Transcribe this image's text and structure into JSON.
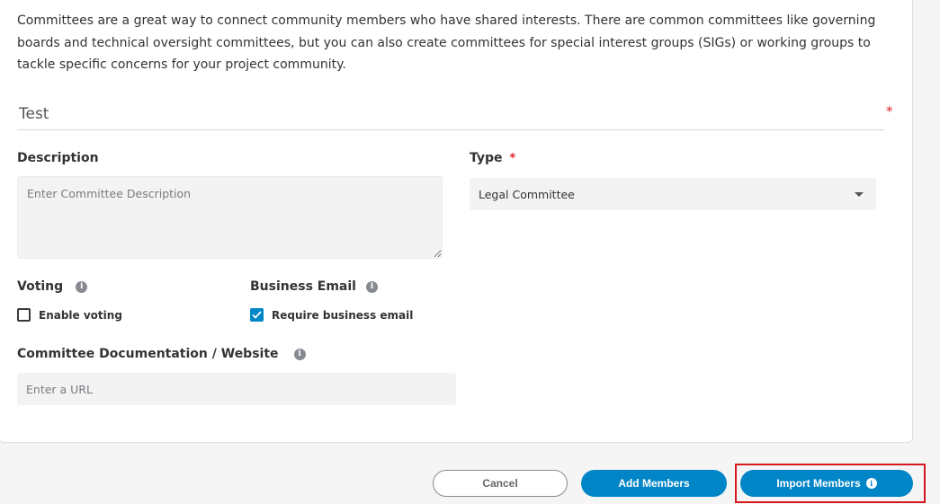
{
  "intro_text": "Committees are a great way to connect community members who have shared interests. There are common committees like governing boards and technical oversight committees, but you can also create committees for special interest groups (SIGs) or working groups to tackle specific concerns for your project community.",
  "name_field": {
    "value": "Test",
    "required_mark": "*"
  },
  "description": {
    "label": "Description",
    "placeholder": "Enter Committee Description"
  },
  "type": {
    "label": "Type",
    "required_mark": "*",
    "selected": "Legal Committee"
  },
  "voting": {
    "label": "Voting",
    "checkbox_label": "Enable voting",
    "checked": false
  },
  "business_email": {
    "label": "Business Email",
    "checkbox_label": "Require business email",
    "checked": true
  },
  "documentation": {
    "label": "Committee Documentation / Website",
    "placeholder": "Enter a URL"
  },
  "buttons": {
    "cancel": "Cancel",
    "add_members": "Add Members",
    "import_members": "Import Members"
  },
  "colors": {
    "primary": "#0085c7",
    "required": "#e0242b",
    "highlight": "#d7191f"
  }
}
